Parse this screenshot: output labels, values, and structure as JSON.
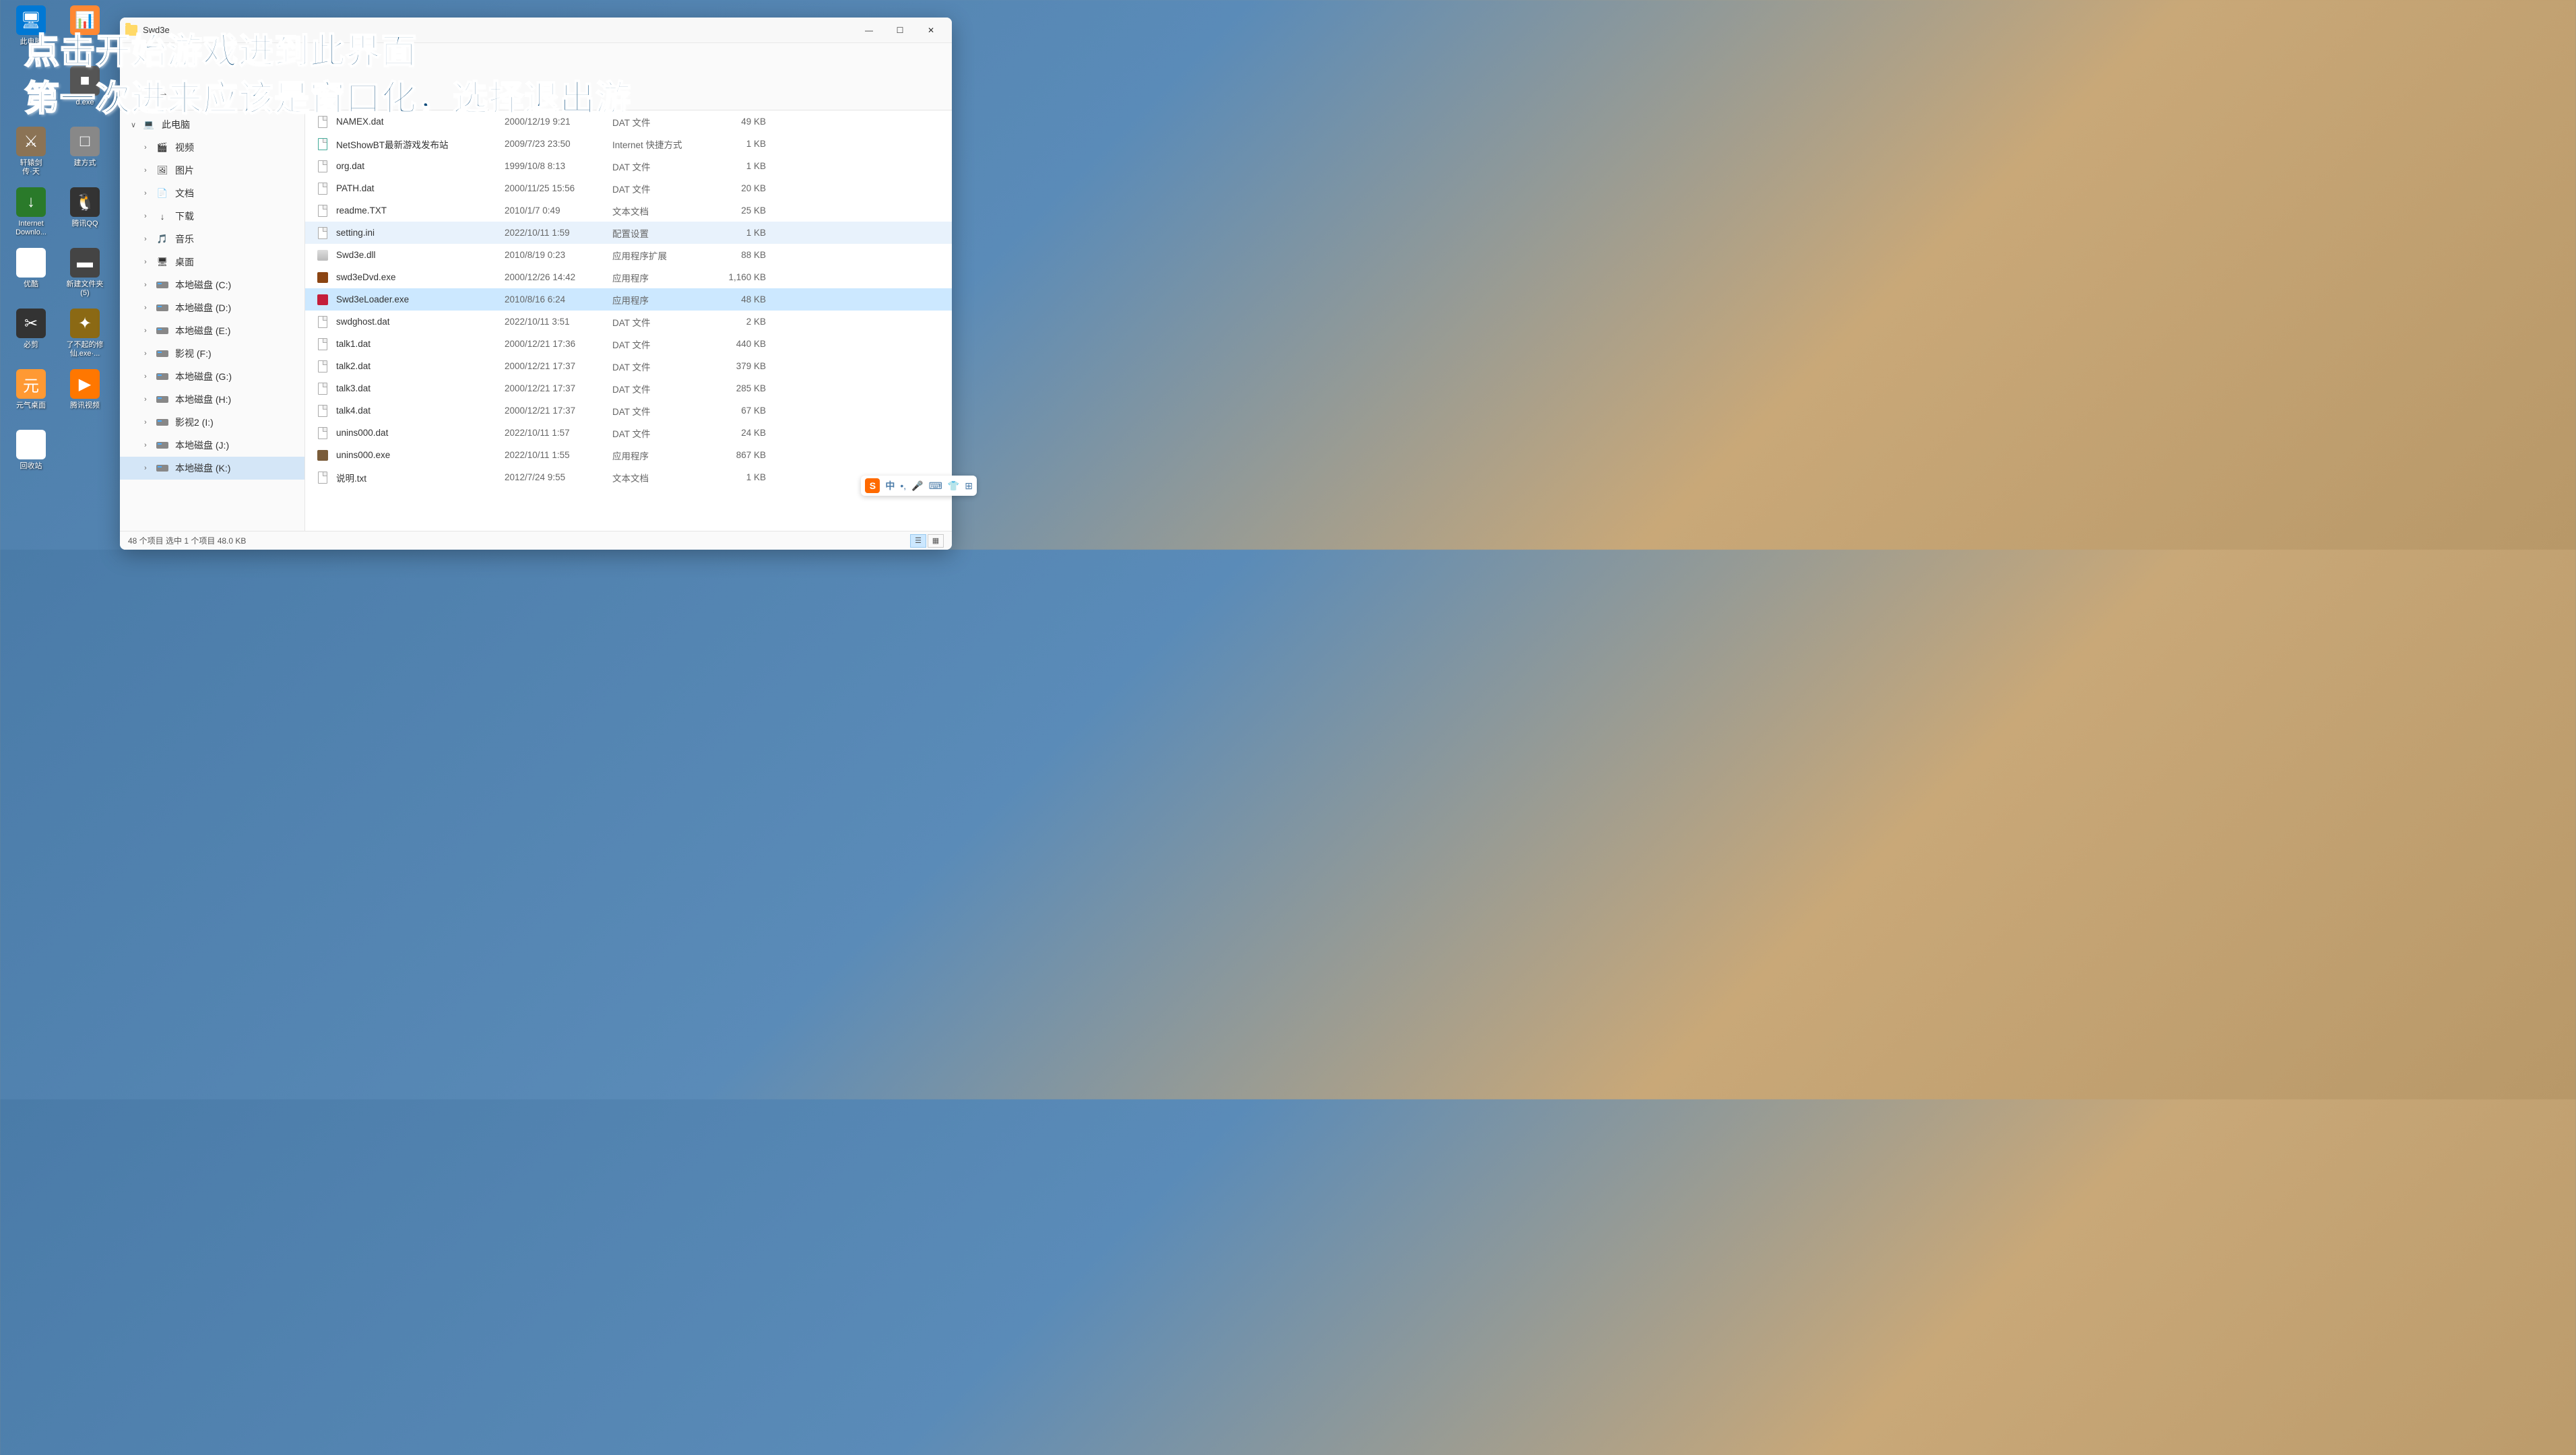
{
  "overlay": {
    "line1": "点击开始游戏进到此界面",
    "line2": "第一次进来应该是窗口化，选择退出游"
  },
  "desktop": {
    "col1": [
      {
        "label": "此电脑",
        "bg": "#0078d4",
        "glyph": "🖥"
      },
      {
        "label": "",
        "bg": "transparent",
        "glyph": ""
      },
      {
        "label": "轩辕剑\n传·天",
        "bg": "#8b7355",
        "glyph": "⚔"
      },
      {
        "label": "Internet\nDownlo...",
        "bg": "#2a7a2a",
        "glyph": "↓"
      },
      {
        "label": "优酷",
        "bg": "#fff",
        "glyph": "▶"
      },
      {
        "label": "必剪",
        "bg": "#333",
        "glyph": "✂"
      },
      {
        "label": "元气桌面",
        "bg": "#ff9933",
        "glyph": "元"
      },
      {
        "label": "回收站",
        "bg": "#fff",
        "glyph": "🗑"
      }
    ],
    "col2": [
      {
        "label": "",
        "bg": "#ff8833",
        "glyph": "📊"
      },
      {
        "label": "d.exe",
        "bg": "#555",
        "glyph": "■"
      },
      {
        "label": "建方式",
        "bg": "#888",
        "glyph": "□"
      },
      {
        "label": "腾讯QQ",
        "bg": "#333",
        "glyph": "🐧"
      },
      {
        "label": "新建文件夹\n(5)",
        "bg": "#444",
        "glyph": "▬"
      },
      {
        "label": "了不起的修\n仙.exe·...",
        "bg": "#8b6914",
        "glyph": "✦"
      },
      {
        "label": "腾讯视频",
        "bg": "#ff7700",
        "glyph": "▶"
      }
    ]
  },
  "window": {
    "title": "Swd3e",
    "statusbar": "48 个项目    选中 1 个项目  48.0 KB"
  },
  "sidebar": [
    {
      "chev": "∨",
      "icon": "💻",
      "label": "此电脑",
      "child": false
    },
    {
      "chev": "›",
      "icon": "🎬",
      "label": "视频",
      "child": true,
      "iconbg": "#7b4fc9"
    },
    {
      "chev": "›",
      "icon": "🖼",
      "label": "图片",
      "child": true,
      "iconbg": "#3a9be8"
    },
    {
      "chev": "›",
      "icon": "📄",
      "label": "文档",
      "child": true,
      "iconbg": "#6b8fc4"
    },
    {
      "chev": "›",
      "icon": "↓",
      "label": "下载",
      "child": true,
      "iconbg": "#4caf50"
    },
    {
      "chev": "›",
      "icon": "🎵",
      "label": "音乐",
      "child": true,
      "iconbg": "#e85d3a"
    },
    {
      "chev": "›",
      "icon": "🖥",
      "label": "桌面",
      "child": true,
      "iconbg": "#3aa8e8"
    },
    {
      "chev": "›",
      "icon": "disk",
      "label": "本地磁盘 (C:)",
      "child": true
    },
    {
      "chev": "›",
      "icon": "disk",
      "label": "本地磁盘 (D:)",
      "child": true
    },
    {
      "chev": "›",
      "icon": "disk",
      "label": "本地磁盘 (E:)",
      "child": true
    },
    {
      "chev": "›",
      "icon": "disk",
      "label": "影视 (F:)",
      "child": true
    },
    {
      "chev": "›",
      "icon": "disk",
      "label": "本地磁盘 (G:)",
      "child": true
    },
    {
      "chev": "›",
      "icon": "disk",
      "label": "本地磁盘 (H:)",
      "child": true
    },
    {
      "chev": "›",
      "icon": "disk",
      "label": "影视2 (I:)",
      "child": true
    },
    {
      "chev": "›",
      "icon": "disk",
      "label": "本地磁盘 (J:)",
      "child": true
    },
    {
      "chev": "›",
      "icon": "disk",
      "label": "本地磁盘 (K:)",
      "child": true,
      "selected": true
    }
  ],
  "files": [
    {
      "name": "NAMEX.dat",
      "date": "2000/12/19 9:21",
      "type": "DAT 文件",
      "size": "49 KB",
      "it": "doc"
    },
    {
      "name": "NetShowBT最新游戏发布站",
      "date": "2009/7/23 23:50",
      "type": "Internet 快捷方式",
      "size": "1 KB",
      "it": "link"
    },
    {
      "name": "org.dat",
      "date": "1999/10/8 8:13",
      "type": "DAT 文件",
      "size": "1 KB",
      "it": "doc"
    },
    {
      "name": "PATH.dat",
      "date": "2000/11/25 15:56",
      "type": "DAT 文件",
      "size": "20 KB",
      "it": "doc"
    },
    {
      "name": "readme.TXT",
      "date": "2010/1/7 0:49",
      "type": "文本文档",
      "size": "25 KB",
      "it": "txt"
    },
    {
      "name": "setting.ini",
      "date": "2022/10/11 1:59",
      "type": "配置设置",
      "size": "1 KB",
      "it": "ini",
      "hover": true
    },
    {
      "name": "Swd3e.dll",
      "date": "2010/8/19 0:23",
      "type": "应用程序扩展",
      "size": "88 KB",
      "it": "dll"
    },
    {
      "name": "swd3eDvd.exe",
      "date": "2000/12/26 14:42",
      "type": "应用程序",
      "size": "1,160 KB",
      "it": "exe1"
    },
    {
      "name": "Swd3eLoader.exe",
      "date": "2010/8/16 6:24",
      "type": "应用程序",
      "size": "48 KB",
      "it": "exe2",
      "selected": true
    },
    {
      "name": "swdghost.dat",
      "date": "2022/10/11 3:51",
      "type": "DAT 文件",
      "size": "2 KB",
      "it": "doc"
    },
    {
      "name": "talk1.dat",
      "date": "2000/12/21 17:36",
      "type": "DAT 文件",
      "size": "440 KB",
      "it": "doc"
    },
    {
      "name": "talk2.dat",
      "date": "2000/12/21 17:37",
      "type": "DAT 文件",
      "size": "379 KB",
      "it": "doc"
    },
    {
      "name": "talk3.dat",
      "date": "2000/12/21 17:37",
      "type": "DAT 文件",
      "size": "285 KB",
      "it": "doc"
    },
    {
      "name": "talk4.dat",
      "date": "2000/12/21 17:37",
      "type": "DAT 文件",
      "size": "67 KB",
      "it": "doc"
    },
    {
      "name": "unins000.dat",
      "date": "2022/10/11 1:57",
      "type": "DAT 文件",
      "size": "24 KB",
      "it": "doc"
    },
    {
      "name": "unins000.exe",
      "date": "2022/10/11 1:55",
      "type": "应用程序",
      "size": "867 KB",
      "it": "exe3"
    },
    {
      "name": "说明.txt",
      "date": "2012/7/24 9:55",
      "type": "文本文档",
      "size": "1 KB",
      "it": "txt"
    }
  ],
  "ime": {
    "mode": "中"
  }
}
